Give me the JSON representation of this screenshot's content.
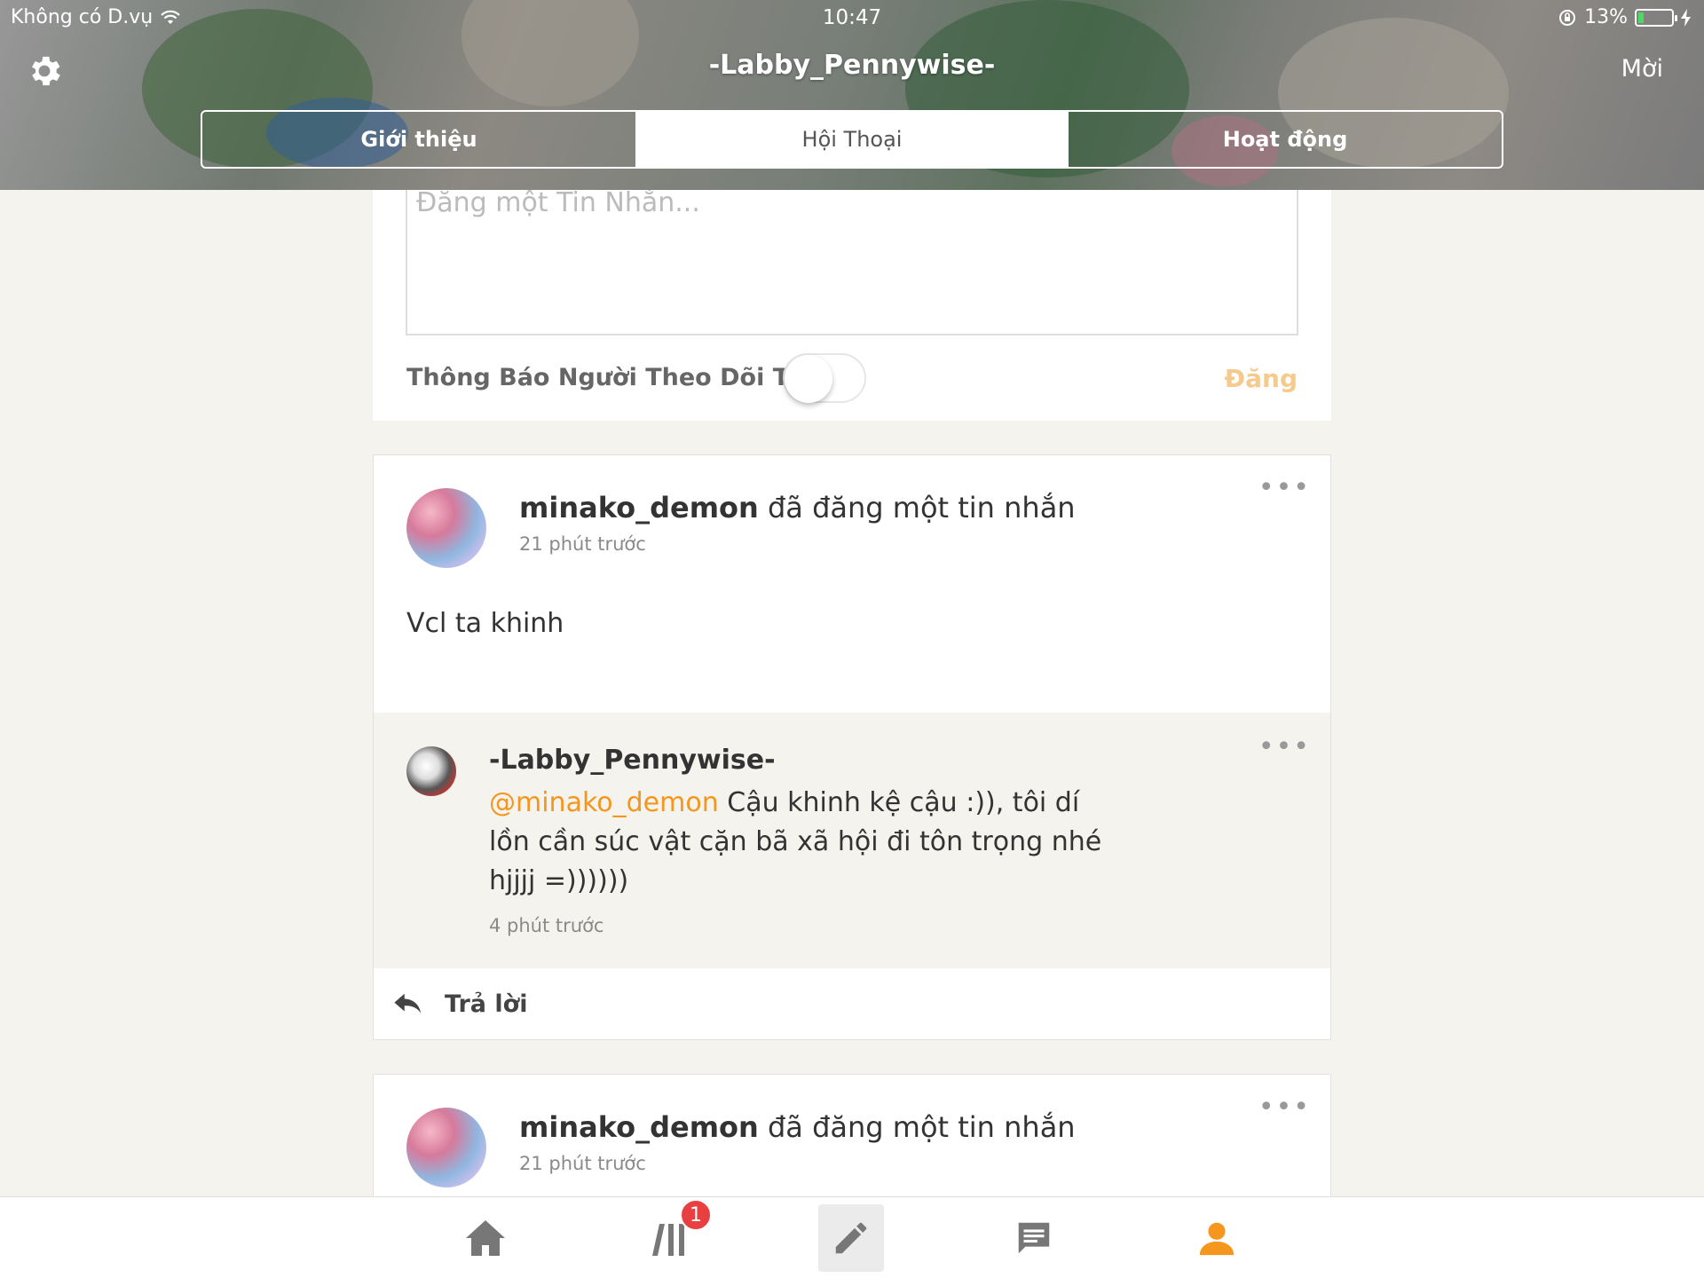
{
  "status_bar": {
    "carrier": "Không có D.vụ",
    "time": "10:47",
    "battery": "13%"
  },
  "header": {
    "title": "-Labby_Pennywise-",
    "invite_label": "Mời",
    "tabs": [
      {
        "label": "Giới thiệu",
        "active": false
      },
      {
        "label": "Hội Thoại",
        "active": true
      },
      {
        "label": "Hoạt động",
        "active": false
      }
    ]
  },
  "composer": {
    "placeholder": "Đăng một Tin Nhắn...",
    "notify_label": "Thông Báo Người Theo Dõi Tôi",
    "notify_on": false,
    "post_label": "Đăng"
  },
  "posts": [
    {
      "author": "minako_demon",
      "action": "đã đăng một tin nhắn",
      "time": "21 phút trước",
      "body": "Vcl ta khinh",
      "reply": {
        "author": "-Labby_Pennywise-",
        "mention": "@minako_demon",
        "text": " Cậu khinh kệ cậu :)), tôi dí lồn cần súc vật cặn bã xã hội đi tôn trọng nhé hjjjj =))))))",
        "time": "4 phút trước"
      },
      "reply_label": "Trả lời"
    },
    {
      "author": "minako_demon",
      "action": "đã đăng một tin nhắn",
      "time": "21 phút trước"
    }
  ],
  "bottom_nav": {
    "badge_count": "1",
    "items": [
      "home-icon",
      "feed-icon",
      "compose-icon",
      "chat-icon",
      "profile-icon"
    ]
  },
  "colors": {
    "accent": "#f5961e",
    "badge": "#e84040",
    "background": "#f5f3ee"
  }
}
